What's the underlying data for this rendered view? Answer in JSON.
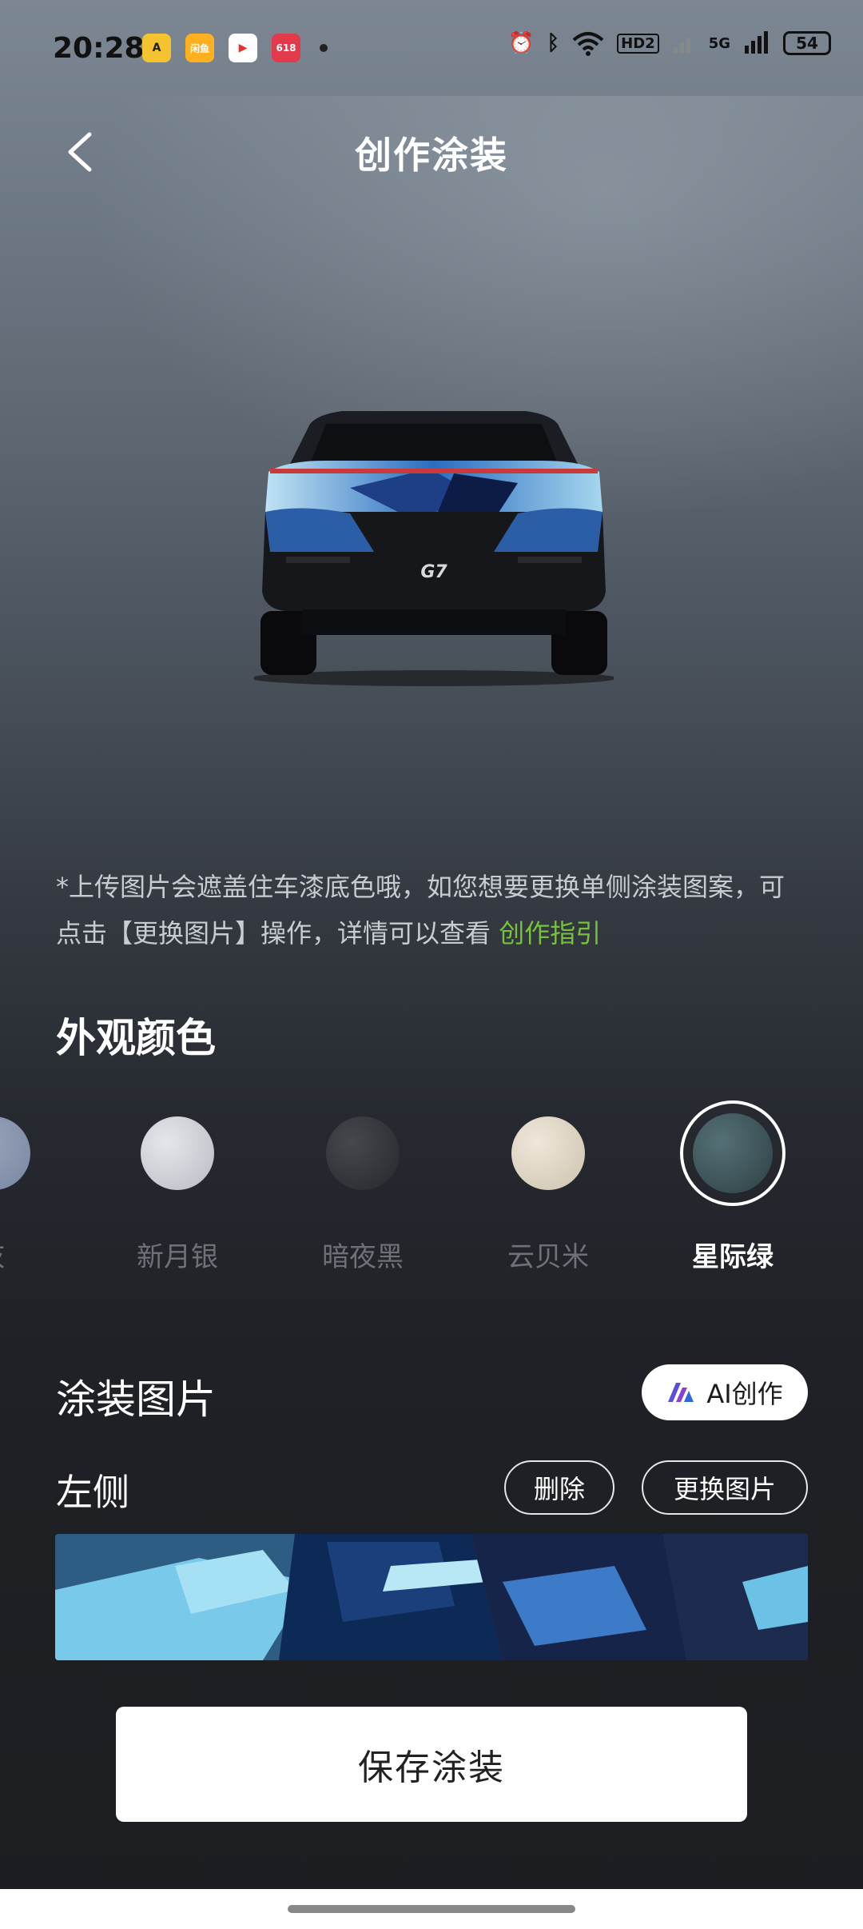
{
  "status_bar": {
    "time": "20:28",
    "battery": "54",
    "network": "5G",
    "hd": "HD2",
    "apps": [
      {
        "name": "amap",
        "color": "#f6c330",
        "label": "A"
      },
      {
        "name": "xianyu",
        "color": "#ffb020",
        "label": "闲鱼"
      },
      {
        "name": "video",
        "color": "#e6322d",
        "label": "▶"
      },
      {
        "name": "618",
        "color": "#e23a4a",
        "label": "618"
      }
    ]
  },
  "header": {
    "title": "创作涂装"
  },
  "notice": {
    "text": "*上传图片会遮盖住车漆底色哦，如您想要更换单侧涂装图案，可点击【更换图片】操作，详情可以查看 ",
    "link": "创作指引"
  },
  "exterior": {
    "title": "外观颜色",
    "colors": [
      {
        "label": "灰",
        "color": "#8593ab",
        "selected": false
      },
      {
        "label": "新月银",
        "color": "#c9ccd1",
        "selected": false
      },
      {
        "label": "暗夜黑",
        "color": "#303236",
        "selected": false
      },
      {
        "label": "云贝米",
        "color": "#ddd3c2",
        "selected": false
      },
      {
        "label": "星际绿",
        "color": "#3d5356",
        "selected": true
      }
    ]
  },
  "wrap": {
    "title": "涂装图片",
    "ai_button": "AI创作",
    "side_label": "左侧",
    "delete_button": "删除",
    "replace_button": "更换图片"
  },
  "car": {
    "badge": "G7"
  },
  "save_button": "保存涂装"
}
